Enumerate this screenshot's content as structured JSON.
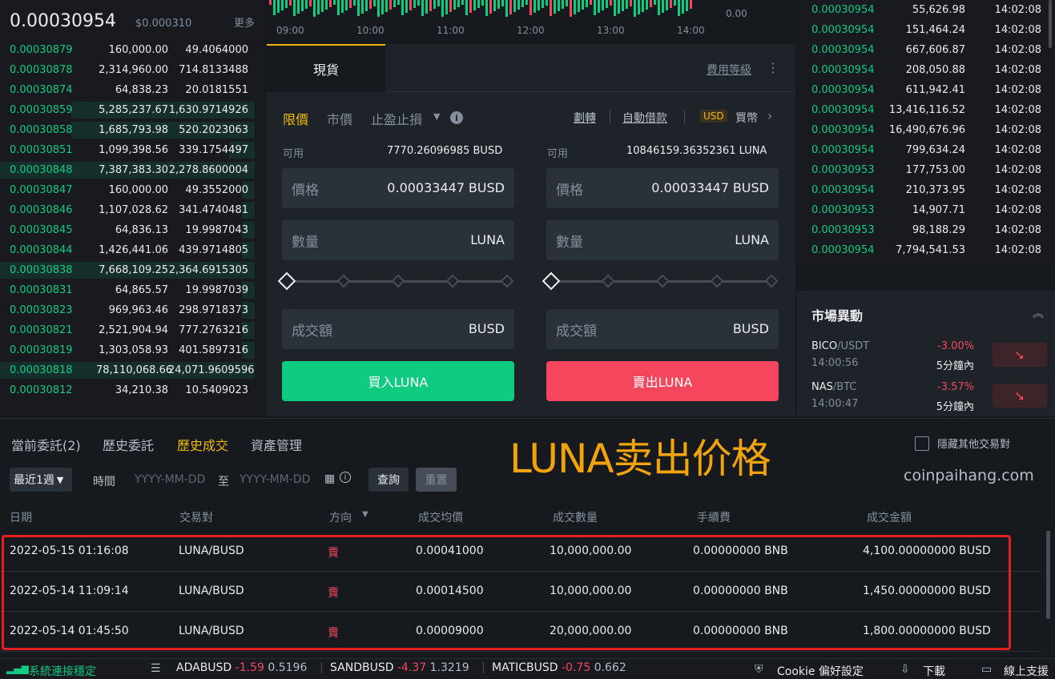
{
  "orderbook": {
    "last_price": "0.00030954",
    "last_price_usd": "$0.000310",
    "more_label": "更多",
    "rows": [
      {
        "price": "0.00030879",
        "amount": "160,000.00",
        "total": "49.4064000",
        "depth": 0.0
      },
      {
        "price": "0.00030878",
        "amount": "2,314,960.00",
        "total": "714.8133488",
        "depth": 0.0
      },
      {
        "price": "0.00030874",
        "amount": "64,838.23",
        "total": "20.0181551",
        "depth": 0.0
      },
      {
        "price": "0.00030859",
        "amount": "5,285,237.67",
        "total": "1,630.9714926",
        "depth": 0.72
      },
      {
        "price": "0.00030858",
        "amount": "1,685,793.98",
        "total": "520.2023063",
        "depth": 0.72
      },
      {
        "price": "0.00030851",
        "amount": "1,099,398.56",
        "total": "339.1754497",
        "depth": 0.1
      },
      {
        "price": "0.00030848",
        "amount": "7,387,383.30",
        "total": "2,278.8600004",
        "depth": 1.0
      },
      {
        "price": "0.00030847",
        "amount": "160,000.00",
        "total": "49.3552000",
        "depth": 0.05
      },
      {
        "price": "0.00030846",
        "amount": "1,107,028.62",
        "total": "341.4740481",
        "depth": 0.05
      },
      {
        "price": "0.00030845",
        "amount": "64,836.13",
        "total": "19.9987043",
        "depth": 0.05
      },
      {
        "price": "0.00030844",
        "amount": "1,426,441.06",
        "total": "439.9714805",
        "depth": 0.05
      },
      {
        "price": "0.00030838",
        "amount": "7,668,109.25",
        "total": "2,364.6915305",
        "depth": 1.0
      },
      {
        "price": "0.00030831",
        "amount": "64,865.57",
        "total": "19.9987039",
        "depth": 0.05
      },
      {
        "price": "0.00030823",
        "amount": "969,963.46",
        "total": "298.9718373",
        "depth": 0.05
      },
      {
        "price": "0.00030821",
        "amount": "2,521,904.94",
        "total": "777.2763216",
        "depth": 0.05
      },
      {
        "price": "0.00030819",
        "amount": "1,303,058.93",
        "total": "401.5897316",
        "depth": 0.05
      },
      {
        "price": "0.00030818",
        "amount": "78,110,068.66",
        "total": "24,071.9609596",
        "depth": 1.0
      },
      {
        "price": "0.00030812",
        "amount": "34,210.38",
        "total": "10.5409023",
        "depth": 0.0
      }
    ]
  },
  "chart": {
    "times": [
      "09:00",
      "10:00",
      "11:00",
      "12:00",
      "13:00",
      "14:00"
    ],
    "y_label": "0.00",
    "up_color": "#0ecb81",
    "down_color": "#f6465d"
  },
  "trade": {
    "tab_spot": "現貨",
    "fee_level": "費用等級",
    "order_types": {
      "limit": "限價",
      "market": "市價",
      "stop": "止盈止損"
    },
    "transfer": "劃轉",
    "auto_borrow": "自動借款",
    "currency_badge": "USD",
    "buy_coin": "買幣",
    "buy": {
      "avail_label": "可用",
      "avail_value": "7770.26096985 BUSD",
      "price_label": "價格",
      "price_value": "0.00033447",
      "price_unit": "BUSD",
      "qty_label": "數量",
      "qty_unit": "LUNA",
      "amount_label": "成交額",
      "amount_unit": "BUSD",
      "button": "買入LUNA"
    },
    "sell": {
      "avail_label": "可用",
      "avail_value": "10846159.36352361 LUNA",
      "price_label": "價格",
      "price_value": "0.00033447",
      "price_unit": "BUSD",
      "qty_label": "數量",
      "qty_unit": "LUNA",
      "amount_label": "成交額",
      "amount_unit": "BUSD",
      "button": "賣出LUNA"
    }
  },
  "trades": [
    {
      "price": "0.00030954",
      "amount": "55,626.98",
      "time": "14:02:08"
    },
    {
      "price": "0.00030954",
      "amount": "151,464.24",
      "time": "14:02:08"
    },
    {
      "price": "0.00030954",
      "amount": "667,606.87",
      "time": "14:02:08"
    },
    {
      "price": "0.00030954",
      "amount": "208,050.88",
      "time": "14:02:08"
    },
    {
      "price": "0.00030954",
      "amount": "611,942.41",
      "time": "14:02:08"
    },
    {
      "price": "0.00030954",
      "amount": "13,416,116.52",
      "time": "14:02:08"
    },
    {
      "price": "0.00030954",
      "amount": "16,490,676.96",
      "time": "14:02:08"
    },
    {
      "price": "0.00030954",
      "amount": "799,634.24",
      "time": "14:02:08"
    },
    {
      "price": "0.00030953",
      "amount": "177,753.00",
      "time": "14:02:08"
    },
    {
      "price": "0.00030954",
      "amount": "210,373.95",
      "time": "14:02:08"
    },
    {
      "price": "0.00030953",
      "amount": "14,907.71",
      "time": "14:02:08"
    },
    {
      "price": "0.00030953",
      "amount": "98,188.29",
      "time": "14:02:08"
    },
    {
      "price": "0.00030954",
      "amount": "7,794,541.53",
      "time": "14:02:08"
    }
  ],
  "market": {
    "title": "市場異動",
    "items": [
      {
        "base": "BICO",
        "quote": "/USDT",
        "time": "14:00:56",
        "change": "-3.00%",
        "period": "5分鐘內"
      },
      {
        "base": "NAS",
        "quote": "/BTC",
        "time": "14:00:47",
        "change": "-3.57%",
        "period": "5分鐘內"
      }
    ]
  },
  "history": {
    "tabs": [
      "當前委託(2)",
      "歷史委託",
      "歷史成交",
      "資產管理"
    ],
    "overlay_text": "LUNA卖出价格",
    "watermark": "coinpaihang.com",
    "hide_other": "隱藏其他交易對",
    "period": "最近1週",
    "time_label": "時間",
    "date_from": "YYYY-MM-DD",
    "to_label": "至",
    "date_to": "YYYY-MM-DD",
    "query": "查詢",
    "reset": "重置",
    "columns": [
      "日期",
      "交易對",
      "方向",
      "成交均價",
      "成交數量",
      "手續費",
      "成交金額"
    ],
    "rows": [
      {
        "date": "2022-05-15 01:16:08",
        "pair": "LUNA/BUSD",
        "dir": "賣",
        "avg": "0.00041000",
        "qty": "10,000,000.00",
        "fee": "0.00000000 BNB",
        "total": "4,100.00000000 BUSD"
      },
      {
        "date": "2022-05-14 11:09:14",
        "pair": "LUNA/BUSD",
        "dir": "賣",
        "avg": "0.00014500",
        "qty": "10,000,000.00",
        "fee": "0.00000000 BNB",
        "total": "1,450.00000000 BUSD"
      },
      {
        "date": "2022-05-14 01:45:50",
        "pair": "LUNA/BUSD",
        "dir": "賣",
        "avg": "0.00009000",
        "qty": "20,000,000.00",
        "fee": "0.00000000 BNB",
        "total": "1,800.00000000 BUSD"
      }
    ]
  },
  "footer": {
    "connection": "系統連接穩定",
    "tickers": [
      {
        "sym": "ADABUSD",
        "chg": "-1.59",
        "price": "0.5196"
      },
      {
        "sym": "SANDBUSD",
        "chg": "-4.37",
        "price": "1.3219"
      },
      {
        "sym": "MATICBUSD",
        "chg": "-0.75",
        "price": "0.662"
      }
    ],
    "cookie": "Cookie 偏好設定",
    "download": "下載",
    "support": "線上支援"
  }
}
